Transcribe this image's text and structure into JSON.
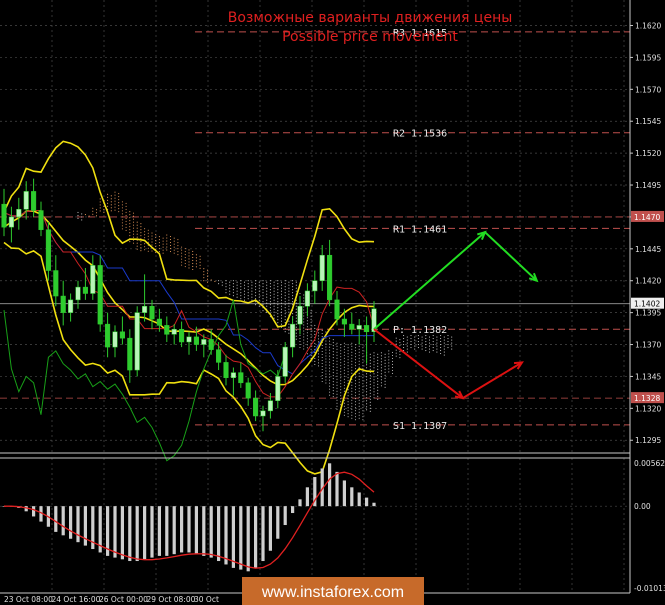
{
  "chart_data": {
    "type": "candlestick",
    "title_ru": "Возможные варианты движения цены",
    "title_en": "Possible price movement",
    "watermark": "www.instaforex.com",
    "price_axis": {
      "ylim": [
        1.2285,
        1.164
      ],
      "ticks": [
        "1.1620",
        "1.1595",
        "1.1570",
        "1.1545",
        "1.1520",
        "1.1495",
        "1.1470",
        "1.1445",
        "1.1420",
        "1.1395",
        "1.1370",
        "1.1345",
        "1.1320",
        "1.1295"
      ],
      "badges": [
        {
          "label": "1.1470",
          "value": 1.147,
          "color": "#c0504d"
        },
        {
          "label": "1.1402",
          "value": 1.1402,
          "color": "#f0f0f0"
        },
        {
          "label": "1.1328",
          "value": 1.1328,
          "color": "#c0504d"
        }
      ]
    },
    "macd_axis": {
      "ticks": [
        "0.00562",
        "0.00",
        "-0.01013"
      ],
      "values": [
        0.00562,
        0.0,
        -0.01013
      ]
    },
    "time_labels": [
      "23 Oct 08:00",
      "24 Oct 16:00",
      "26 Oct 00:00",
      "29 Oct 08:00",
      "30 Oct"
    ],
    "levels": [
      {
        "label": "R3 1.1615",
        "value": 1.1615
      },
      {
        "label": "R2 1.1536",
        "value": 1.1536
      },
      {
        "label": "R1 1.1461",
        "value": 1.1461
      },
      {
        "label": "P: 1.1382",
        "value": 1.1382
      },
      {
        "label": "S1 1.1307",
        "value": 1.1307
      }
    ],
    "candles": [
      [
        1.148,
        1.1492,
        1.1455,
        1.1462
      ],
      [
        1.1462,
        1.1478,
        1.145,
        1.147
      ],
      [
        1.147,
        1.1485,
        1.146,
        1.1476
      ],
      [
        1.1476,
        1.1498,
        1.1468,
        1.149
      ],
      [
        1.149,
        1.15,
        1.147,
        1.1475
      ],
      [
        1.1475,
        1.1482,
        1.1455,
        1.146
      ],
      [
        1.146,
        1.1466,
        1.142,
        1.1428
      ],
      [
        1.1428,
        1.144,
        1.14,
        1.1408
      ],
      [
        1.1408,
        1.142,
        1.1385,
        1.1395
      ],
      [
        1.1395,
        1.141,
        1.1388,
        1.1405
      ],
      [
        1.1405,
        1.142,
        1.1398,
        1.1415
      ],
      [
        1.1415,
        1.143,
        1.1405,
        1.141
      ],
      [
        1.141,
        1.144,
        1.1405,
        1.1432
      ],
      [
        1.1432,
        1.144,
        1.138,
        1.1386
      ],
      [
        1.1386,
        1.1395,
        1.136,
        1.1368
      ],
      [
        1.1368,
        1.1385,
        1.136,
        1.138
      ],
      [
        1.138,
        1.1392,
        1.137,
        1.1375
      ],
      [
        1.1375,
        1.1382,
        1.134,
        1.135
      ],
      [
        1.135,
        1.14,
        1.1345,
        1.1395
      ],
      [
        1.1395,
        1.1425,
        1.1388,
        1.14
      ],
      [
        1.14,
        1.1405,
        1.1382,
        1.139
      ],
      [
        1.139,
        1.1398,
        1.138,
        1.1385
      ],
      [
        1.1385,
        1.1392,
        1.1372,
        1.1378
      ],
      [
        1.1378,
        1.1386,
        1.137,
        1.1382
      ],
      [
        1.1382,
        1.1388,
        1.1368,
        1.1372
      ],
      [
        1.1372,
        1.138,
        1.1362,
        1.1376
      ],
      [
        1.1376,
        1.1384,
        1.1365,
        1.137
      ],
      [
        1.137,
        1.1378,
        1.136,
        1.1374
      ],
      [
        1.1374,
        1.1382,
        1.1362,
        1.1366
      ],
      [
        1.1366,
        1.1372,
        1.135,
        1.1356
      ],
      [
        1.1356,
        1.1362,
        1.1338,
        1.1344
      ],
      [
        1.1344,
        1.1352,
        1.133,
        1.1348
      ],
      [
        1.1348,
        1.1356,
        1.1336,
        1.134
      ],
      [
        1.134,
        1.1344,
        1.1322,
        1.1328
      ],
      [
        1.1328,
        1.1334,
        1.131,
        1.1314
      ],
      [
        1.1314,
        1.1322,
        1.1302,
        1.1318
      ],
      [
        1.1318,
        1.1332,
        1.1312,
        1.1326
      ],
      [
        1.1326,
        1.135,
        1.132,
        1.1345
      ],
      [
        1.1345,
        1.1372,
        1.134,
        1.1368
      ],
      [
        1.1368,
        1.1392,
        1.136,
        1.1386
      ],
      [
        1.1386,
        1.1408,
        1.1378,
        1.14
      ],
      [
        1.14,
        1.1418,
        1.1392,
        1.1412
      ],
      [
        1.1412,
        1.1428,
        1.1402,
        1.142
      ],
      [
        1.142,
        1.1448,
        1.1412,
        1.144
      ],
      [
        1.144,
        1.1452,
        1.14,
        1.1405
      ],
      [
        1.1405,
        1.1412,
        1.1385,
        1.139
      ],
      [
        1.139,
        1.1398,
        1.1376,
        1.1386
      ],
      [
        1.1386,
        1.1395,
        1.1378,
        1.1382
      ],
      [
        1.1382,
        1.139,
        1.137,
        1.1385
      ],
      [
        1.1385,
        1.1392,
        1.1355,
        1.138
      ],
      [
        1.138,
        1.1404,
        1.1372,
        1.1398
      ]
    ],
    "macd_hist": [
      0.0,
      0.0,
      -0.0002,
      -0.0006,
      -0.0012,
      -0.0018,
      -0.0024,
      -0.003,
      -0.0034,
      -0.0038,
      -0.0042,
      -0.0046,
      -0.005,
      -0.0054,
      -0.0058,
      -0.006,
      -0.0062,
      -0.0064,
      -0.0064,
      -0.0062,
      -0.006,
      -0.0058,
      -0.0058,
      -0.0056,
      -0.0054,
      -0.0054,
      -0.0056,
      -0.0058,
      -0.006,
      -0.0064,
      -0.0068,
      -0.0072,
      -0.0074,
      -0.0076,
      -0.0072,
      -0.0064,
      -0.0052,
      -0.0038,
      -0.0022,
      -0.0008,
      0.0008,
      0.0022,
      0.0034,
      0.0044,
      0.005,
      0.004,
      0.003,
      0.0022,
      0.0016,
      0.001,
      0.0004
    ],
    "forecast": [
      {
        "name": "up",
        "color": "#22dd22",
        "points": [
          [
            1.1382,
            50
          ],
          [
            1.1458,
            65
          ],
          [
            1.142,
            72
          ]
        ]
      },
      {
        "name": "down",
        "color": "#dd1111",
        "points": [
          [
            1.1382,
            50
          ],
          [
            1.1328,
            62
          ],
          [
            1.1356,
            70
          ]
        ]
      }
    ],
    "colors": {
      "grid": "#4a4a4a",
      "axis_border": "#c8c8c8",
      "bull_candle": "#b8f5b8",
      "bear_candle": "#2ecc2e",
      "bollinger": "#f0e010",
      "tenkan": "#cc2222",
      "kijun": "#1a3acc",
      "chikou": "#18a018",
      "kumo_up": "#f0a060",
      "kumo_down": "#cccccc",
      "macd_hist": "#cfcfcf",
      "macd_signal": "#e02020",
      "level_line": "#c0504d",
      "title": "#e02020"
    }
  }
}
